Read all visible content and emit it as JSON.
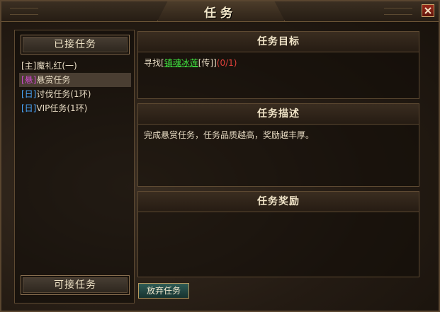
{
  "window": {
    "title": "任务"
  },
  "left": {
    "accepted_tab": "已接任务",
    "available_tab": "可接任务",
    "quests": [
      {
        "tag": "[主]",
        "name": "魔礼红(一)",
        "tag_color": "#e8dcc4",
        "selected": false
      },
      {
        "tag": "[悬]",
        "name": "悬赏任务",
        "tag_color": "#d04ad0",
        "selected": true
      },
      {
        "tag": "[日]",
        "name": "讨伐任务(1环)",
        "tag_color": "#4aa8ff",
        "selected": false
      },
      {
        "tag": "[日]",
        "name": "VIP任务(1环)",
        "tag_color": "#4aa8ff",
        "selected": false
      }
    ]
  },
  "goal": {
    "heading": "任务目标",
    "prefix": "寻找[",
    "target": "镇魂冰莲",
    "suffix": "[传]]",
    "progress_open": "(",
    "progress": "0/1",
    "progress_close": ")"
  },
  "description": {
    "heading": "任务描述",
    "text": "完成悬赏任务，任务品质越高，奖励越丰厚。"
  },
  "reward": {
    "heading": "任务奖励"
  },
  "actions": {
    "abandon_label": "放弃任务"
  },
  "colors": {
    "link": "#3fe03f",
    "progress": "#e0403a",
    "accent": "#c9a46a"
  }
}
